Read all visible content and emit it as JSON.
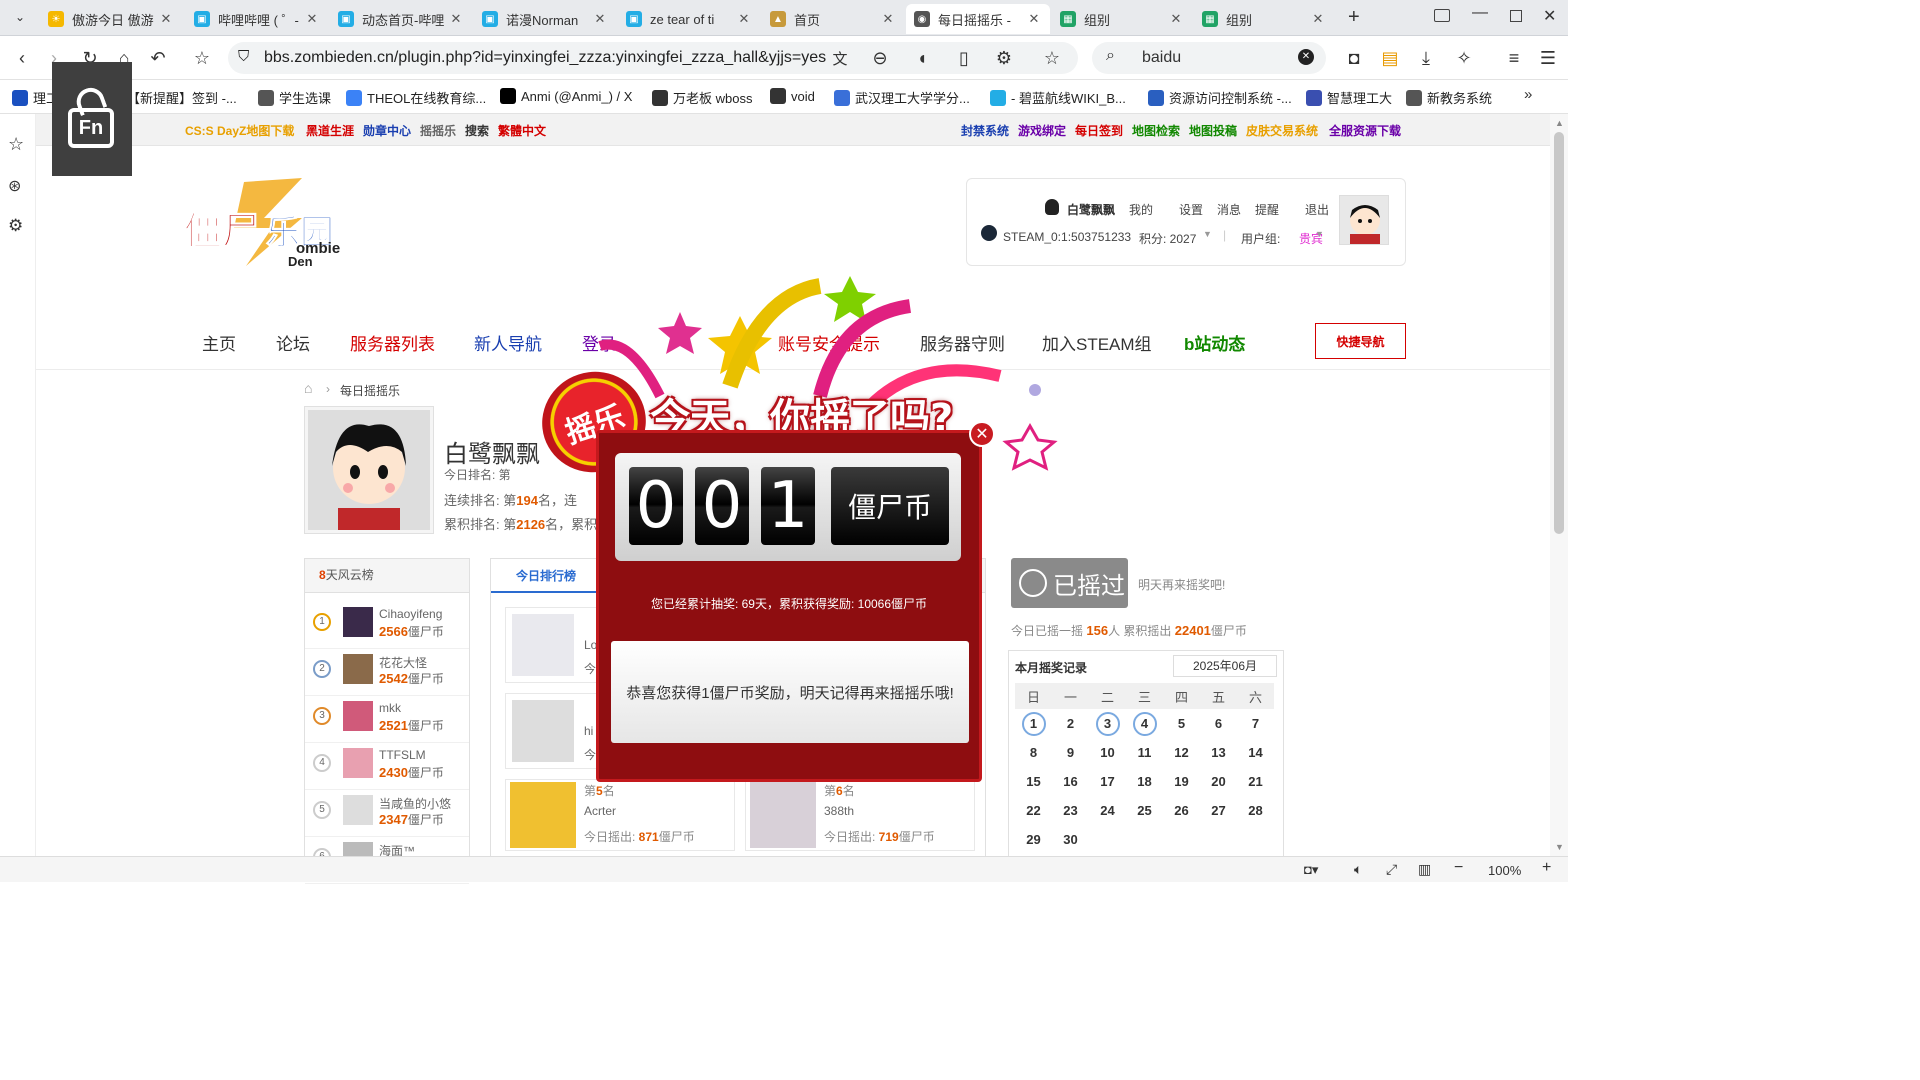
{
  "tabs": [
    {
      "label": "傲游今日 傲游",
      "color": "#f5b800",
      "glyph": "☀"
    },
    {
      "label": "哔哩哔哩 ( ゜-",
      "color": "#23ade5",
      "glyph": "▣"
    },
    {
      "label": "动态首页-哔哩",
      "color": "#23ade5",
      "glyph": "▣"
    },
    {
      "label": "诺漫Norman",
      "color": "#23ade5",
      "glyph": "▣"
    },
    {
      "label": "ze tear of ti",
      "color": "#23ade5",
      "glyph": "▣"
    },
    {
      "label": "首页",
      "color": "#c79a3b",
      "glyph": "▲"
    },
    {
      "label": "每日摇摇乐 -",
      "color": "#555",
      "glyph": "◉"
    },
    {
      "label": "组别",
      "color": "#21a366",
      "glyph": "▦"
    },
    {
      "label": "组别",
      "color": "#21a366",
      "glyph": "▦"
    }
  ],
  "address": {
    "url": "bbs.zombieden.cn/plugin.php?id=yinxingfei_zzza:yinxingfei_zzza_hall&yjjs=yes",
    "search": "baidu"
  },
  "bookmarks": [
    "理工智课",
    "【新提醒】签到 -...",
    "学生选课",
    "THEOL在线教育综...",
    "Anmi (@Anmi_) / X",
    "万老板 wboss",
    "void",
    "武汉理工大学学分...",
    "- 碧蓝航线WIKI_B...",
    "资源访问控制系统 -...",
    "智慧理工大",
    "新教务系统"
  ],
  "fn_overlay": "Fn",
  "topline": {
    "left": [
      {
        "t": "CS:S DayZ地图下载",
        "c": "#e8a000"
      },
      {
        "t": "黑道生涯",
        "c": "#d40000"
      },
      {
        "t": "勋章中心",
        "c": "#1a3fb0"
      },
      {
        "t": "摇摇乐",
        "c": "#666"
      },
      {
        "t": "搜索",
        "c": "#333"
      },
      {
        "t": "繁體中文",
        "c": "#d40000"
      }
    ],
    "right": [
      {
        "t": "封禁系统",
        "c": "#1a3fb0"
      },
      {
        "t": "游戏绑定",
        "c": "#6a00a8"
      },
      {
        "t": "每日签到",
        "c": "#d40000"
      },
      {
        "t": "地图检索",
        "c": "#118800"
      },
      {
        "t": "地图投稿",
        "c": "#118800"
      },
      {
        "t": "皮肤交易系统",
        "c": "#e8a000"
      },
      {
        "t": "全服资源下载",
        "c": "#6a00a8"
      }
    ]
  },
  "logo": {
    "line1": "僵尸乐园",
    "line2": "ombie",
    "line3": "Den"
  },
  "user": {
    "name": "白鹭飘飘",
    "links": [
      "我的",
      "设置",
      "消息",
      "提醒",
      "退出"
    ],
    "steam": "STEAM_0:1:503751233",
    "points": "积分: 2027",
    "group_label": "用户组:",
    "group": "贵宾"
  },
  "nav": [
    {
      "t": "主页",
      "c": "#333"
    },
    {
      "t": "论坛",
      "c": "#333"
    },
    {
      "t": "服务器列表",
      "c": "#d40000"
    },
    {
      "t": "新人导航",
      "c": "#1a3fb0"
    },
    {
      "t": "登录",
      "c": "#6a00a8"
    },
    {
      "t": "账号安全提示",
      "c": "#d40000"
    },
    {
      "t": "服务器守则",
      "c": "#333"
    },
    {
      "t": "加入STEAM组",
      "c": "#333"
    },
    {
      "t": "b站动态",
      "c": "#118800"
    }
  ],
  "quick_nav": "快捷导航",
  "breadcrumb": "每日摇摇乐",
  "profile": {
    "name": "白鹭飘飘",
    "today_rank": "今日排名: 第",
    "streak_rank_pre": "连续排名: 第",
    "streak_rank": "194",
    "streak_rank_post": "名，连",
    "total_rank_pre": "累积排名: 第",
    "total_rank": "2126",
    "total_rank_post": "名，累积"
  },
  "cloud": {
    "title_num": "8",
    "title": "天风云榜",
    "items": [
      {
        "rank": "1",
        "name": "Cihaoyifeng",
        "val": "2566",
        "unit": "僵尸币"
      },
      {
        "rank": "2",
        "name": "花花大怪",
        "val": "2542",
        "unit": "僵尸币"
      },
      {
        "rank": "3",
        "name": "mkk",
        "val": "2521",
        "unit": "僵尸币"
      },
      {
        "rank": "4",
        "name": "TTFSLM",
        "val": "2430",
        "unit": "僵尸币"
      },
      {
        "rank": "5",
        "name": "当咸鱼的小悠",
        "val": "2347",
        "unit": "僵尸币"
      },
      {
        "rank": "6",
        "name": "海面™",
        "val": "",
        "unit": ""
      }
    ]
  },
  "today_tab": "今日排行榜",
  "today_cards": [
    {
      "rank_pre": "第",
      "rank": "5",
      "rank_post": "名",
      "name": "Acrter",
      "today": "今日摇出: ",
      "val": "871",
      "unit": "僵尸币"
    },
    {
      "rank_pre": "第",
      "rank": "6",
      "rank_post": "名",
      "name": "388th",
      "today": "今日摇出: ",
      "val": "719",
      "unit": "僵尸币"
    }
  ],
  "card_partial": [
    "Lo",
    "今",
    "hi",
    "今"
  ],
  "shaken": {
    "btn": "已摇过",
    "hint": "明天再来摇奖吧!",
    "stats_pre": "今日已摇一摇",
    "stats_people": "156",
    "stats_mid": "人 累积摇出",
    "stats_total": "22401",
    "stats_unit": "僵尸币"
  },
  "calendar": {
    "title": "本月摇奖记录",
    "month": "2025年06月",
    "weekdays": [
      "日",
      "一",
      "二",
      "三",
      "四",
      "五",
      "六"
    ],
    "weeks": [
      [
        "1",
        "2",
        "3",
        "4",
        "5",
        "6",
        "7"
      ],
      [
        "8",
        "9",
        "10",
        "11",
        "12",
        "13",
        "14"
      ],
      [
        "15",
        "16",
        "17",
        "18",
        "19",
        "20",
        "21"
      ],
      [
        "22",
        "23",
        "24",
        "25",
        "26",
        "27",
        "28"
      ],
      [
        "29",
        "30",
        "",
        "",
        "",
        "",
        ""
      ]
    ],
    "marked": [
      "1",
      "3",
      "4"
    ]
  },
  "popup": {
    "badge": "摇乐",
    "headline": "今天，你摇了吗?",
    "digits": [
      "0",
      "0",
      "1"
    ],
    "currency": "僵尸币",
    "summary": "您已经累计抽奖: 69天，累积获得奖励: 10066僵尸币",
    "message": "恭喜您获得1僵尸币奖励，明天记得再来摇摇乐哦!"
  },
  "status": {
    "zoom": "100%"
  }
}
